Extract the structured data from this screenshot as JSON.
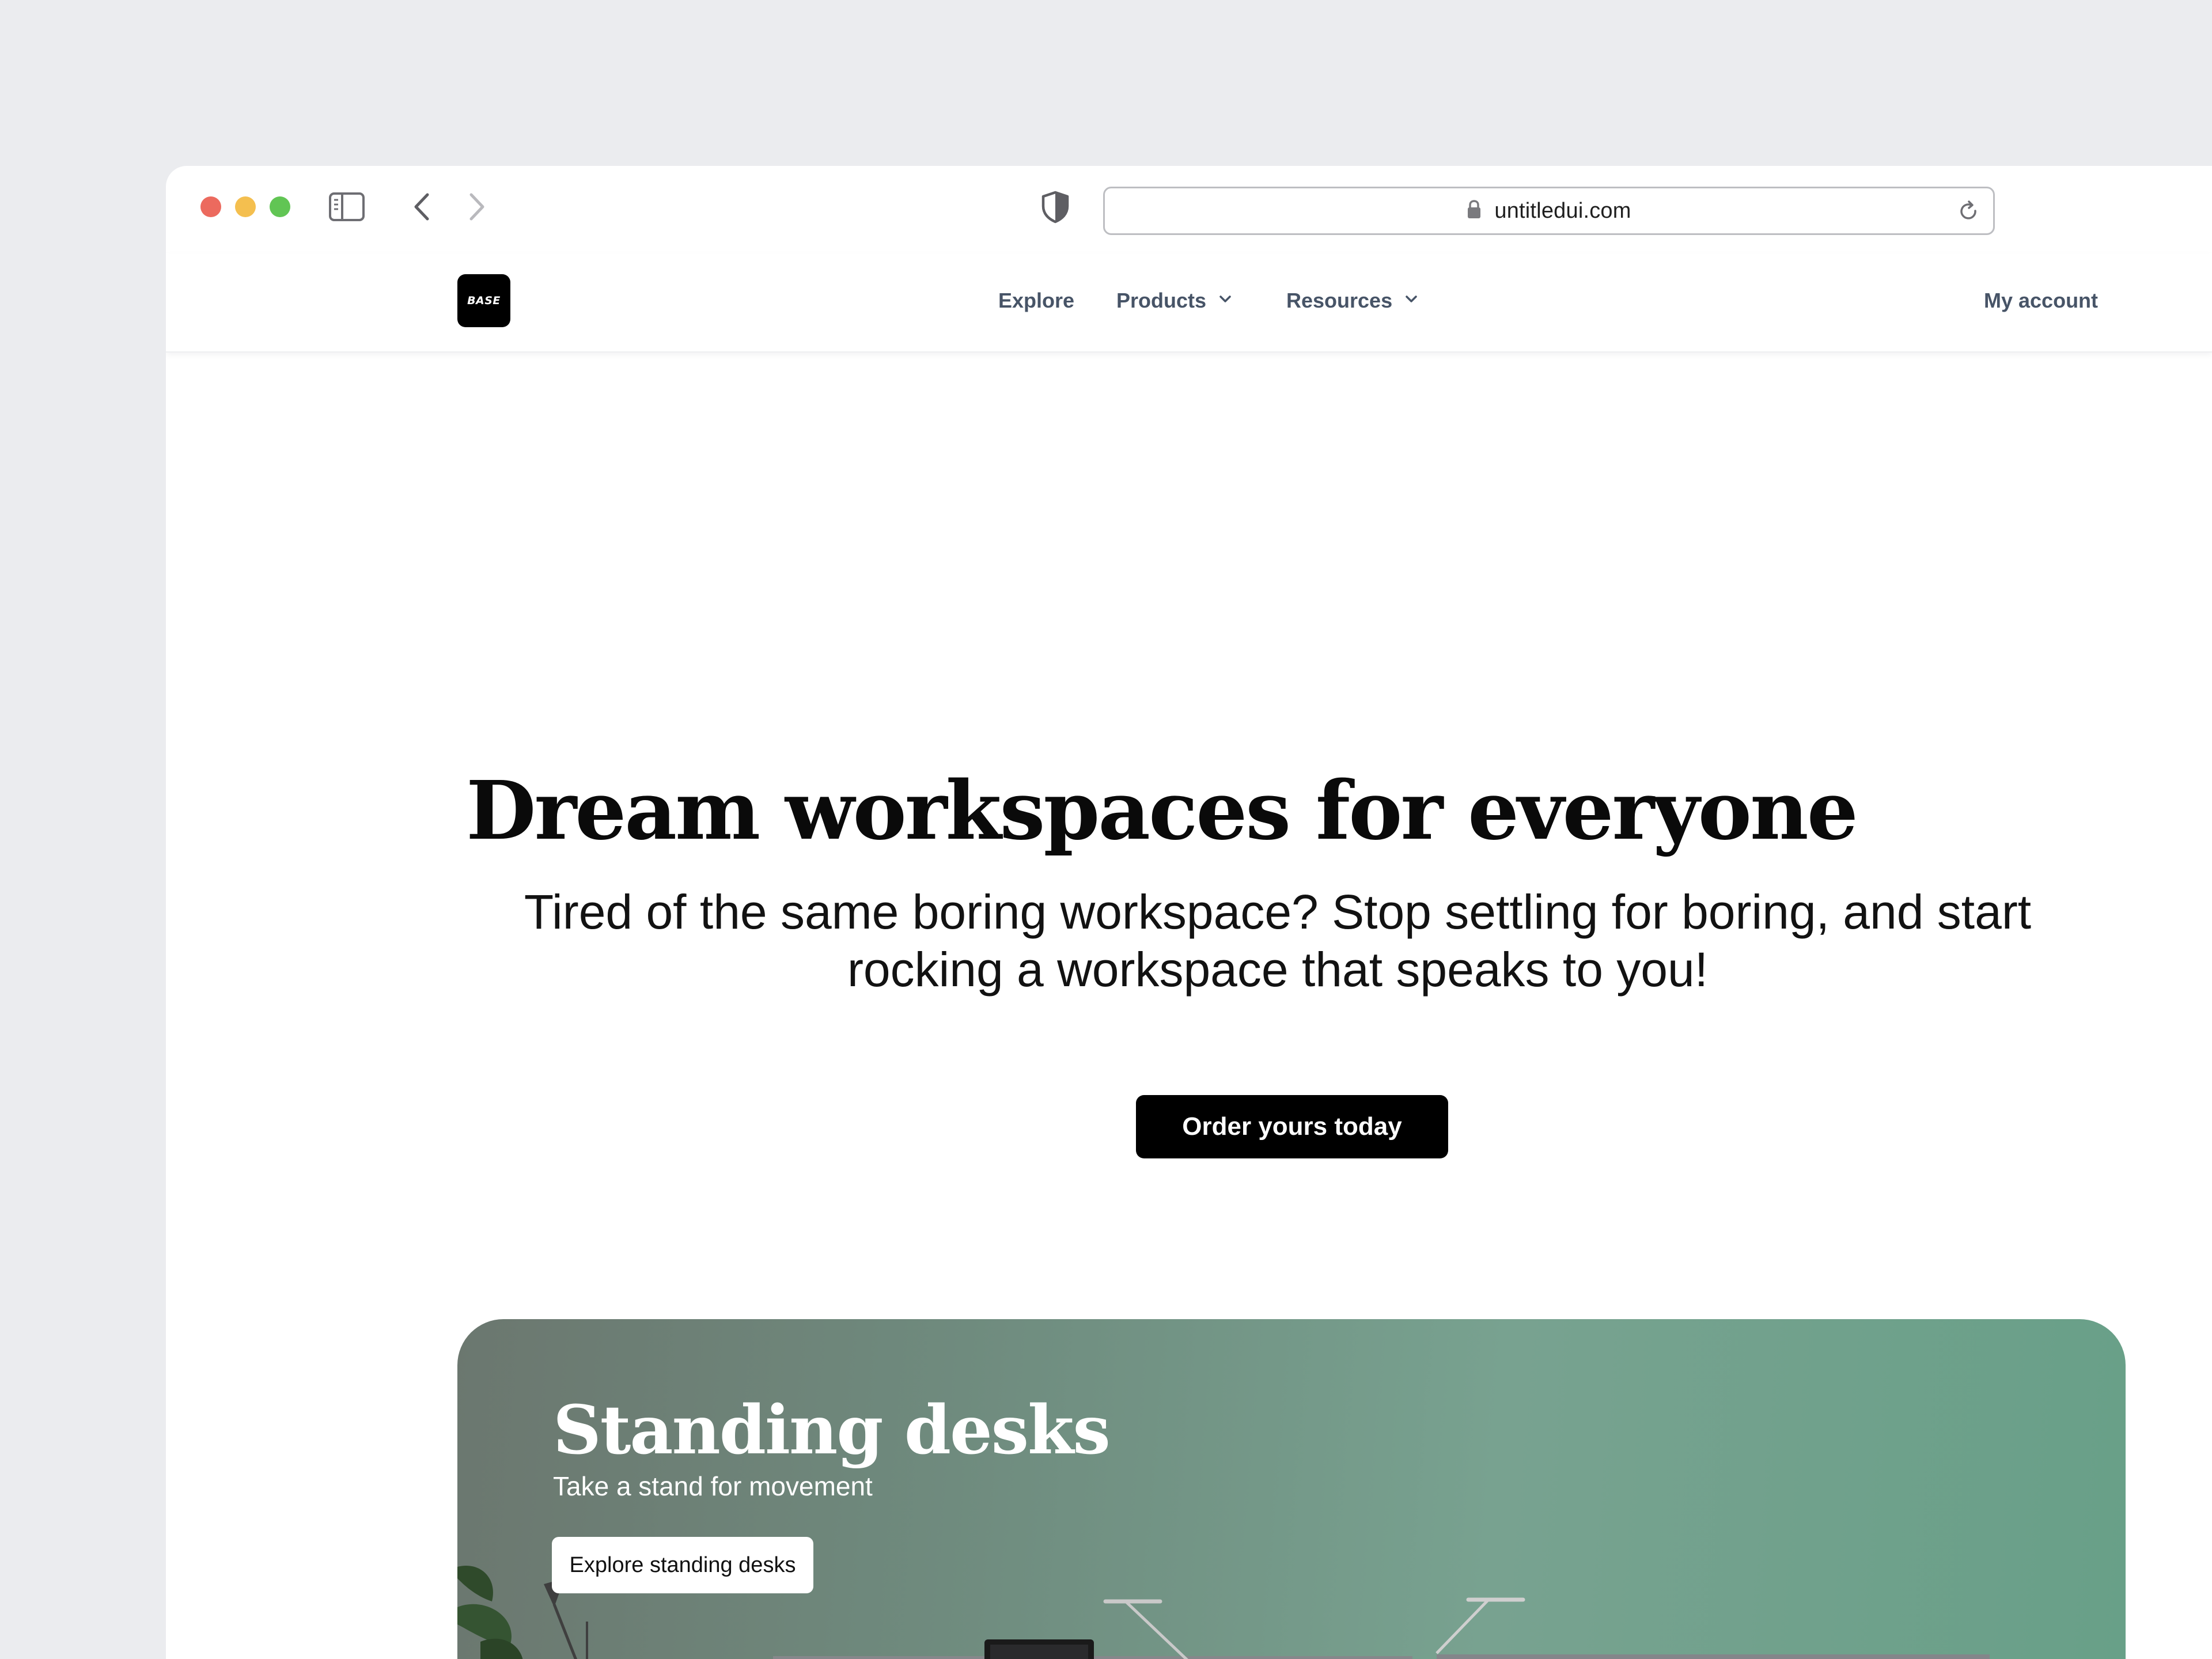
{
  "browser": {
    "url": "untitledui.com",
    "icons": {
      "sidebar": "sidebar-toggle-icon",
      "back": "chevron-left-icon",
      "forward": "chevron-right-icon",
      "privacy": "shield-icon",
      "lock": "lock-icon",
      "reload": "reload-icon"
    }
  },
  "header": {
    "logo_text": "BASE",
    "nav": {
      "explore": "Explore",
      "products": "Products",
      "resources": "Resources"
    },
    "account": "My account"
  },
  "hero": {
    "title": "Dream workspaces for everyone",
    "subtitle": "Tired of the same boring workspace? Stop settling for boring, and start rocking a workspace that speaks to you!",
    "cta": "Order yours today"
  },
  "feature_card": {
    "title": "Standing desks",
    "subtitle": "Take a stand for movement",
    "button": "Explore standing desks",
    "image": "office-standing-desks-photo"
  },
  "colors": {
    "page_background": "#EBECEF",
    "nav_text": "#475467",
    "cta_background": "#000000",
    "card_green": "#6F9A87"
  }
}
